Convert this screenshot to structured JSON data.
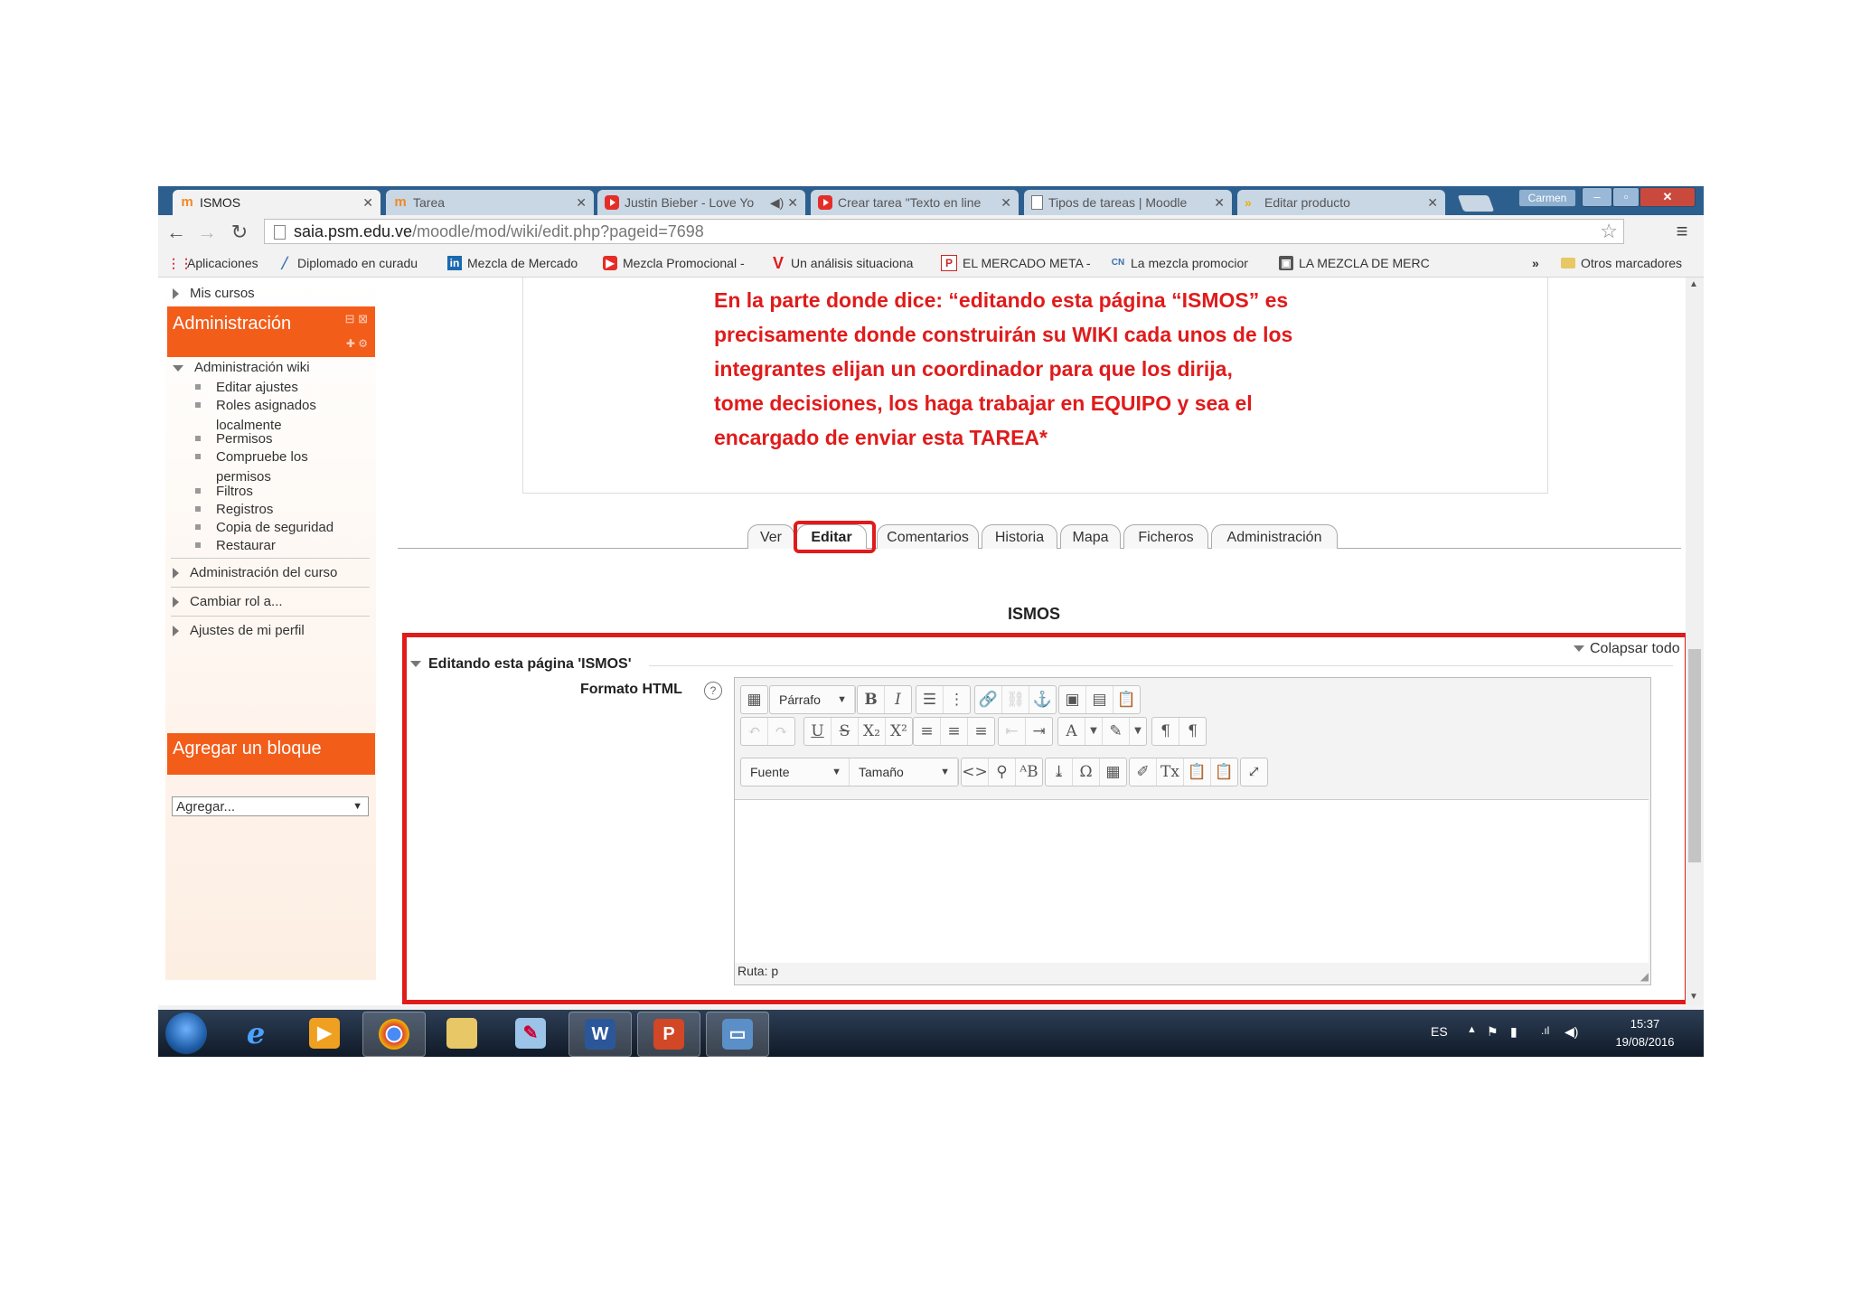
{
  "browser": {
    "tabs": [
      {
        "label": "ISMOS",
        "favicon": "moodle-icon",
        "active": true
      },
      {
        "label": "Tarea",
        "favicon": "moodle-icon",
        "active": false
      },
      {
        "label": "Justin Bieber - Love Yo",
        "favicon": "youtube-icon",
        "active": false
      },
      {
        "label": "Crear tarea \"Texto en line",
        "favicon": "youtube-icon",
        "active": false
      },
      {
        "label": "Tipos de tareas | Moodle",
        "favicon": "document-icon",
        "active": false
      },
      {
        "label": "Editar producto",
        "favicon": "product-icon",
        "active": false
      }
    ],
    "window_user": "Carmen",
    "url_host": "saia.psm.edu.ve",
    "url_path": "/moodle/mod/wiki/edit.php?pageid=7698",
    "bookmarks": [
      {
        "label": "Aplicaciones",
        "icon": "apps-grid-icon"
      },
      {
        "label": "Diplomado en curadu",
        "icon": "pen-icon"
      },
      {
        "label": "Mezcla de Mercado",
        "icon": "linkedin-icon"
      },
      {
        "label": "Mezcla Promocional -",
        "icon": "youtube-icon"
      },
      {
        "label": "Un análisis situaciona",
        "icon": "v-logo-icon"
      },
      {
        "label": "EL MERCADO META -",
        "icon": "p-logo-icon"
      },
      {
        "label": "La mezcla promocion",
        "icon": "cn-logo-icon"
      },
      {
        "label": "LA MEZCLA DE MERC",
        "icon": "image-icon"
      }
    ],
    "bookmarks_more": "»",
    "other_bookmarks": "Otros marcadores"
  },
  "sidebar": {
    "my_courses": "Mis cursos",
    "admin_title": "Administración",
    "wiki_admin": "Administración wiki",
    "wiki_admin_items": [
      "Editar ajustes",
      "Roles asignados localmente",
      "Permisos",
      "Compruebe los permisos",
      "Filtros",
      "Registros",
      "Copia de seguridad",
      "Restaurar"
    ],
    "course_admin": "Administración del curso",
    "switch_role": "Cambiar rol a...",
    "profile_settings": "Ajustes de mi perfil",
    "add_block_title": "Agregar un bloque",
    "add_block_select": "Agregar..."
  },
  "annotation": {
    "lines": [
      "En la parte donde dice: “editando esta página “ISMOS” es",
      "precisamente donde construirán su WIKI cada unos de los",
      "integrantes elijan un coordinador para que los dirija,",
      "tome decisiones, los haga trabajar en EQUIPO y sea el",
      "encargado de enviar esta TAREA*"
    ]
  },
  "page_tabs": [
    "Ver",
    "Editar",
    "Comentarios",
    "Historia",
    "Mapa",
    "Ficheros",
    "Administración"
  ],
  "selected_tab": "Editar",
  "page_title": "ISMOS",
  "collapse_all": "Colapsar todo",
  "editing_legend": "Editando esta página 'ISMOS'",
  "format_label": "Formato HTML",
  "editor": {
    "paragraph_select": "Párrafo",
    "font_select": "Fuente",
    "size_select": "Tamaño",
    "path": "Ruta: p"
  },
  "taskbar": {
    "language": "ES",
    "time": "15:37",
    "date": "19/08/2016"
  },
  "colors": {
    "accent_orange": "#f35d1a",
    "annotation_red": "#e01b1b",
    "titlebar_blue": "#2c5f8e"
  }
}
